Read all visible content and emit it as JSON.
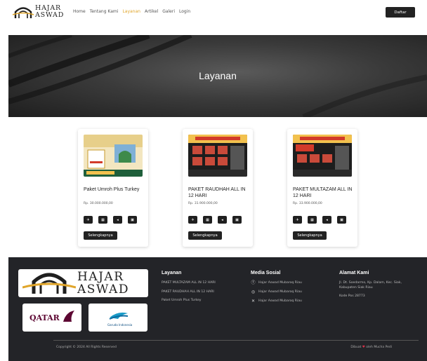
{
  "brand": {
    "name_line1": "HAJAR",
    "name_line2": "ASWAD"
  },
  "nav": {
    "items": [
      {
        "label": "Home"
      },
      {
        "label": "Tentang Kami"
      },
      {
        "label": "Layanan",
        "active": true
      },
      {
        "label": "Artikel"
      },
      {
        "label": "Galeri"
      },
      {
        "label": "Login"
      }
    ],
    "register_label": "Daftar",
    "active_color": "#e0a52a"
  },
  "hero": {
    "title": "Layanan"
  },
  "cards": [
    {
      "title": "Paket Umroh Plus Turkey",
      "price": "Rp. 30.000.000,00",
      "button": "Selengkapnya"
    },
    {
      "title": "PAKET RAUDHAH ALL IN 12 HARI",
      "price": "Rp. 31.900.000,00",
      "button": "Selengkapnya"
    },
    {
      "title": "PAKET MULTAZAM ALL IN 12 HARI",
      "price": "Rp. 33.900.000,00",
      "button": "Selengkapnya"
    }
  ],
  "footer": {
    "brand": {
      "name_line1": "HAJAR",
      "name_line2": "ASWAD"
    },
    "partners": [
      {
        "name": "QATAR"
      },
      {
        "name": "Garuda Indonesia"
      }
    ],
    "layanan": {
      "heading": "Layanan",
      "items": [
        "PAKET MULTAZAM ALL IN 12 HARI",
        "PAKET RAUDHAH ALL IN 12 HARI",
        "Paket Umroh Plus Turkey"
      ]
    },
    "media": {
      "heading": "Media Sosial",
      "items": [
        {
          "icon": "facebook-icon",
          "label": "Hajar Aswad Mubaroq Riau"
        },
        {
          "icon": "instagram-icon",
          "label": "Hajar Aswad Mubaroq Riau"
        },
        {
          "icon": "x-icon",
          "label": "Hajar Aswad Mubaroq Riau"
        }
      ]
    },
    "alamat": {
      "heading": "Alamat Kami",
      "lines": [
        "Jl. Dt. Soedarmo, Kp. Dalam, Kec. Siak,",
        "Kabupaten Siak Riau"
      ],
      "postal": "Kode Pos 28773"
    },
    "copyright": "Copyright © 2024 All Rights Reserved",
    "credit_prefix": "Dibuat",
    "credit_suffix": "oleh Mucha Pedi"
  }
}
